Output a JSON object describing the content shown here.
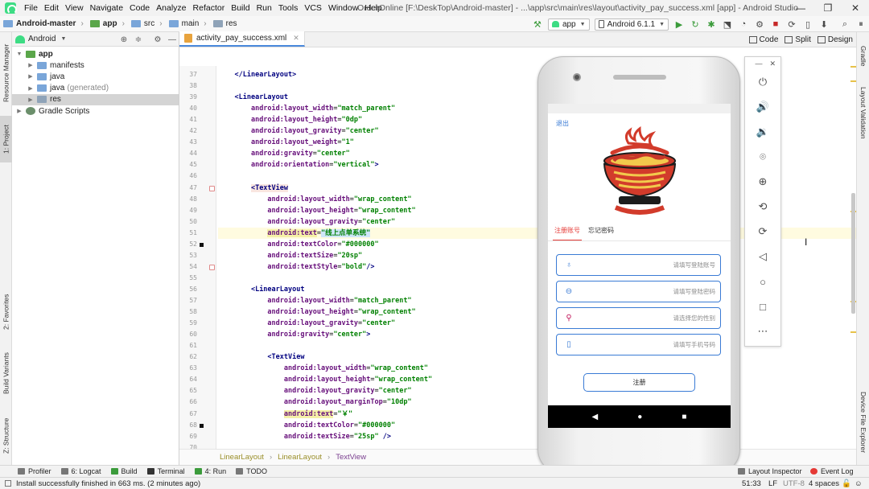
{
  "menubar": {
    "items": [
      "File",
      "Edit",
      "View",
      "Navigate",
      "Code",
      "Analyze",
      "Refactor",
      "Build",
      "Run",
      "Tools",
      "VCS",
      "Window",
      "Help"
    ],
    "title": "OrderOnline [F:\\DeskTop\\Android-master] - ...\\app\\src\\main\\res\\layout\\activity_pay_success.xml [app] - Android Studio"
  },
  "navbar": {
    "crumbs": [
      "Android-master",
      "app",
      "src",
      "main",
      "res"
    ],
    "run_config": "app",
    "device": "Android 6.1.1"
  },
  "left_strip": {
    "tabs": [
      "Resource Manager",
      "1: Project",
      "2: Favorites",
      "Build Variants",
      "Z: Structure"
    ]
  },
  "right_strip": {
    "tabs": [
      "Gradle",
      "Layout Validation",
      "Device File Explorer"
    ]
  },
  "project": {
    "view_mode": "Android",
    "tree": [
      {
        "label": "app",
        "level": 0,
        "kind": "app",
        "expanded": true
      },
      {
        "label": "manifests",
        "level": 1,
        "kind": "folder",
        "expanded": false
      },
      {
        "label": "java",
        "level": 1,
        "kind": "folder",
        "expanded": false
      },
      {
        "label": "java",
        "suffix": "(generated)",
        "level": 1,
        "kind": "folder",
        "expanded": false
      },
      {
        "label": "res",
        "level": 1,
        "kind": "res",
        "expanded": false,
        "selected": true
      },
      {
        "label": "Gradle Scripts",
        "level": 0,
        "kind": "gradle",
        "expanded": false
      }
    ]
  },
  "editor": {
    "tab_label": "activity_pay_success.xml",
    "modes": [
      "Code",
      "Split",
      "Design"
    ],
    "lines": [
      {
        "n": "37",
        "html": "    <span class='tag'>&lt;/LinearLayout&gt;</span>"
      },
      {
        "n": "38",
        "html": ""
      },
      {
        "n": "39",
        "html": "    <span class='tag'>&lt;LinearLayout</span>"
      },
      {
        "n": "40",
        "html": "        <span class='attr'>android:layout_width</span>=<span class='str'>\"match_parent\"</span>"
      },
      {
        "n": "41",
        "html": "        <span class='attr'>android:layout_height</span>=<span class='str'>\"0dp\"</span>"
      },
      {
        "n": "42",
        "html": "        <span class='attr'>android:layout_gravity</span>=<span class='str'>\"center\"</span>"
      },
      {
        "n": "43",
        "html": "        <span class='attr'>android:layout_weight</span>=<span class='str'>\"1\"</span>"
      },
      {
        "n": "44",
        "html": "        <span class='attr'>android:gravity</span>=<span class='str'>\"center\"</span>"
      },
      {
        "n": "45",
        "html": "        <span class='attr'>android:orientation</span>=<span class='str'>\"vertical\"</span><span class='tag'>&gt;</span>"
      },
      {
        "n": "46",
        "html": ""
      },
      {
        "n": "47",
        "html": "        <span class='tag hl'>&lt;TextView</span>"
      },
      {
        "n": "48",
        "html": "            <span class='attr'>android:layout_width</span>=<span class='str'>\"wrap_content\"</span>"
      },
      {
        "n": "49",
        "html": "            <span class='attr'>android:layout_height</span>=<span class='str'>\"wrap_content\"</span>"
      },
      {
        "n": "50",
        "html": "            <span class='attr'>android:layout_gravity</span>=<span class='str'>\"center\"</span>"
      },
      {
        "n": "51",
        "html": "            <span class='attr hl'>android:text</span>=<span class='str sel'>\"线上点单系统\"</span>"
      },
      {
        "n": "52",
        "html": "            <span class='attr'>android:textColor</span>=<span class='str'>\"#000000\"</span>"
      },
      {
        "n": "53",
        "html": "            <span class='attr'>android:textSize</span>=<span class='str'>\"20sp\"</span>"
      },
      {
        "n": "54",
        "html": "            <span class='attr'>android:textStyle</span>=<span class='str'>\"bold\"</span><span class='tag'>/&gt;</span>"
      },
      {
        "n": "55",
        "html": ""
      },
      {
        "n": "56",
        "html": "        <span class='tag'>&lt;LinearLayout</span>"
      },
      {
        "n": "57",
        "html": "            <span class='attr'>android:layout_width</span>=<span class='str'>\"match_parent\"</span>"
      },
      {
        "n": "58",
        "html": "            <span class='attr'>android:layout_height</span>=<span class='str'>\"wrap_content\"</span>"
      },
      {
        "n": "59",
        "html": "            <span class='attr'>android:layout_gravity</span>=<span class='str'>\"center\"</span>"
      },
      {
        "n": "60",
        "html": "            <span class='attr'>android:gravity</span>=<span class='str'>\"center\"</span><span class='tag'>&gt;</span>"
      },
      {
        "n": "61",
        "html": ""
      },
      {
        "n": "62",
        "html": "            <span class='tag'>&lt;TextView</span>"
      },
      {
        "n": "63",
        "html": "                <span class='attr'>android:layout_width</span>=<span class='str'>\"wrap_content\"</span>"
      },
      {
        "n": "64",
        "html": "                <span class='attr'>android:layout_height</span>=<span class='str'>\"wrap_content\"</span>"
      },
      {
        "n": "65",
        "html": "                <span class='attr'>android:layout_gravity</span>=<span class='str'>\"center\"</span>"
      },
      {
        "n": "66",
        "html": "                <span class='attr'>android:layout_marginTop</span>=<span class='str'>\"10dp\"</span>"
      },
      {
        "n": "67",
        "html": "                <span class='attr hl'>android:text</span>=<span class='str'>\"￥\"</span>"
      },
      {
        "n": "68",
        "html": "                <span class='attr'>android:textColor</span>=<span class='str'>\"#000000\"</span>"
      },
      {
        "n": "69",
        "html": "                <span class='attr'>android:textSize</span>=<span class='str'>\"25sp\"</span> <span class='tag'>/&gt;</span>"
      },
      {
        "n": "70",
        "html": ""
      }
    ],
    "breadcrumb": [
      "LinearLayout",
      "LinearLayout",
      "TextView"
    ]
  },
  "phone": {
    "logout": "退出",
    "tabs": [
      "注册账号",
      "忘记密码"
    ],
    "fields": [
      {
        "icon": "user-icon",
        "placeholder": "请填写登陆账号"
      },
      {
        "icon": "lock-icon",
        "placeholder": "请填写登陆密码"
      },
      {
        "icon": "gender-icon",
        "placeholder": "请选择您的性别"
      },
      {
        "icon": "phone-icon",
        "placeholder": "请填写手机号码"
      }
    ],
    "register_label": "注册",
    "nav": [
      "◀",
      "●",
      "■"
    ],
    "colors": {
      "accent": "#3a7bd5",
      "tab_active": "#e53935"
    }
  },
  "emulator_panel": {
    "icons": [
      "power-icon",
      "volume-up-icon",
      "volume-down-icon",
      "camera-icon",
      "zoom-icon",
      "rotate-left-icon",
      "rotate-right-icon",
      "back-icon",
      "home-icon",
      "overview-icon",
      "more-icon"
    ]
  },
  "bottombar": {
    "tabs": [
      "Profiler",
      "6: Logcat",
      "Build",
      "Terminal",
      "4: Run",
      "TODO"
    ],
    "right_tabs": [
      "Layout Inspector",
      "Event Log"
    ]
  },
  "status": {
    "message": "Install successfully finished in 663 ms. (2 minutes ago)",
    "position": "51:33",
    "line_sep": "LF",
    "encoding": "UTF-8",
    "indent": "4 spaces"
  }
}
